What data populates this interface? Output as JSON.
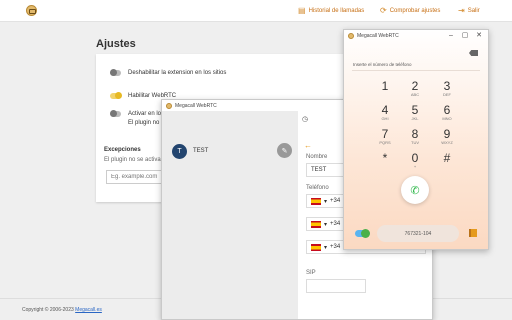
{
  "topbar": {
    "call_history": "Historial de llamadas",
    "check_settings": "Comprobar ajustes",
    "logout": "Salir"
  },
  "settings": {
    "title": "Ajustes",
    "options": [
      {
        "label": "Deshabilitar la extension en los sitios",
        "on": false
      },
      {
        "label": "Habilitar WebRTC",
        "on": true
      },
      {
        "label": "Activar en lo",
        "on": false
      }
    ],
    "plugin_note": "El plugin no",
    "exceptions_title": "Excepciones",
    "exceptions_note": "El plugin no se activa",
    "exceptions_placeholder": "Eg. example.com"
  },
  "footer": {
    "copyright": "Copyright © 2006-2023",
    "link": "Megacall.es"
  },
  "contacts_window": {
    "title": "Megacall WebRTC",
    "contact": {
      "initial": "T",
      "name": "TEST"
    },
    "form": {
      "name_label": "Nombre",
      "name_value": "TEST",
      "phone_label": "Teléfono",
      "phones": [
        "+34",
        "+34",
        "+34"
      ],
      "sip_label": "SIP"
    }
  },
  "dialer_window": {
    "title": "Megacall WebRTC",
    "prompt": "Inserte el número de teléfono",
    "keys": [
      {
        "d": "1",
        "l": ""
      },
      {
        "d": "2",
        "l": "ABC"
      },
      {
        "d": "3",
        "l": "DEF"
      },
      {
        "d": "4",
        "l": "GHI"
      },
      {
        "d": "5",
        "l": "JKL"
      },
      {
        "d": "6",
        "l": "MNO"
      },
      {
        "d": "7",
        "l": "PQRS"
      },
      {
        "d": "8",
        "l": "TUV"
      },
      {
        "d": "9",
        "l": "WXYZ"
      },
      {
        "d": "*",
        "l": ""
      },
      {
        "d": "0",
        "l": "+"
      },
      {
        "d": "#",
        "l": ""
      }
    ],
    "extension": "767321-104"
  },
  "colors": {
    "accent": "#e59a1d",
    "call": "#2eb84a",
    "avatar": "#23456f"
  }
}
